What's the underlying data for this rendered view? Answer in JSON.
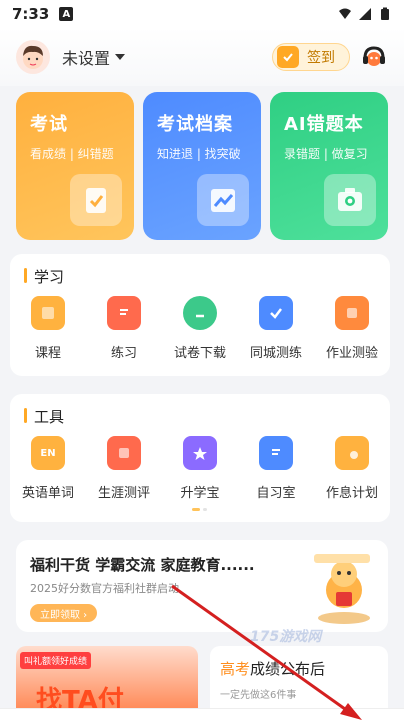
{
  "status_bar": {
    "time": "7:33",
    "badge": "A"
  },
  "header": {
    "user_name": "未设置",
    "checkin_label": "签到"
  },
  "top_cards": [
    {
      "title": "考试",
      "subtitle": "看成绩 | 纠错题",
      "icon": "clipboard-check-icon"
    },
    {
      "title": "考试档案",
      "subtitle": "知进退 | 找突破",
      "icon": "trend-chart-icon"
    },
    {
      "title": "AI错题本",
      "subtitle": "录错题 | 做复习",
      "icon": "camera-icon"
    }
  ],
  "study": {
    "title": "学习",
    "items": [
      {
        "label": "课程",
        "color": "#ffb23f"
      },
      {
        "label": "练习",
        "color": "#ff6a4d"
      },
      {
        "label": "试卷下载",
        "color": "#3cc98a"
      },
      {
        "label": "同城测练",
        "color": "#4e8bff"
      },
      {
        "label": "作业测验",
        "color": "#ff8a3d"
      }
    ]
  },
  "tools": {
    "title": "工具",
    "items": [
      {
        "label": "英语单词",
        "color": "#ffb23f",
        "icon_text": "EN"
      },
      {
        "label": "生涯测评",
        "color": "#ff6a4d"
      },
      {
        "label": "升学宝",
        "color": "#8b6bff"
      },
      {
        "label": "自习室",
        "color": "#4e8bff"
      },
      {
        "label": "作息计划",
        "color": "#ffb23f"
      }
    ]
  },
  "promo": {
    "title": "福利干货 学霸交流 家庭教育......",
    "subtitle": "2025好分数官方福利社群启动",
    "button": "立即领取 ›"
  },
  "bottom_left": {
    "tag": "叫礼额领好成绩",
    "big_text": "找TA付"
  },
  "bottom_right": {
    "title_highlight": "高考",
    "title_rest": "成绩公布后",
    "subtitle": "一定先做这6件事"
  },
  "watermark": "175游戏网"
}
